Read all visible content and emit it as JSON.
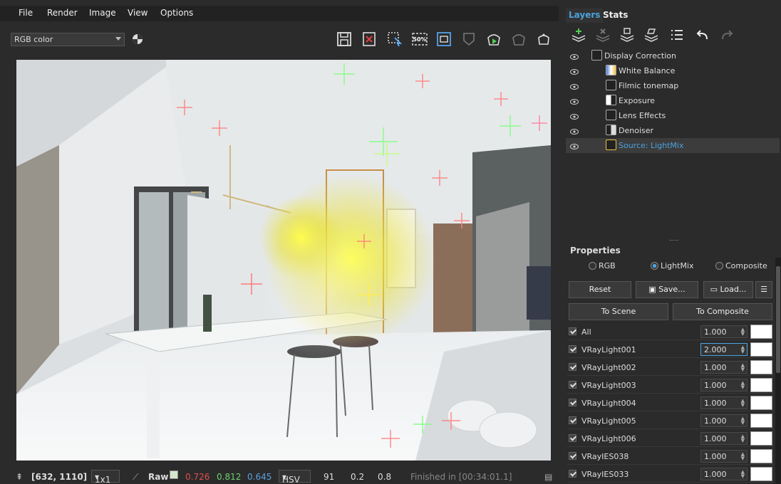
{
  "menu": [
    "File",
    "Render",
    "Image",
    "View",
    "Options"
  ],
  "channel_select": "RGB color",
  "toolbar_icons": [
    "save-icon",
    "clear-icon",
    "region-icon",
    "scale-50-icon",
    "frame-icon",
    "track-icon",
    "render-icon",
    "interactive-render-icon",
    "teapot-icon"
  ],
  "scale_label": "50%",
  "tabs": {
    "layers": "Layers",
    "stats": "Stats"
  },
  "layers": [
    {
      "name": "Display Correction"
    },
    {
      "name": "White Balance"
    },
    {
      "name": "Filmic tonemap"
    },
    {
      "name": "Exposure"
    },
    {
      "name": "Lens Effects"
    },
    {
      "name": "Denoiser"
    },
    {
      "name": "Source: LightMix"
    }
  ],
  "properties": {
    "title": "Properties",
    "modes": [
      "RGB",
      "LightMix",
      "Composite"
    ],
    "selected_mode": "LightMix",
    "reset": "Reset",
    "save": "Save...",
    "load": "Load...",
    "to_scene": "To Scene",
    "to_composite": "To Composite",
    "lights": [
      {
        "name": "All",
        "value": "1.000"
      },
      {
        "name": "VRayLight001",
        "value": "2.000"
      },
      {
        "name": "VRayLight002",
        "value": "1.000"
      },
      {
        "name": "VRayLight003",
        "value": "1.000"
      },
      {
        "name": "VRayLight004",
        "value": "1.000"
      },
      {
        "name": "VRayLight005",
        "value": "1.000"
      },
      {
        "name": "VRayLight006",
        "value": "1.000"
      },
      {
        "name": "VRayIES038",
        "value": "1.000"
      },
      {
        "name": "VRayIES033",
        "value": "1.000"
      }
    ]
  },
  "status": {
    "coords": "[632, 1110]",
    "zoom": "1x1",
    "mode": "Raw",
    "r": "0.726",
    "g": "0.812",
    "b": "0.645",
    "colorspace": "HSV",
    "h": "91",
    "s": "0.2",
    "v": "0.8",
    "finished": "Finished in [00:34:01.1]"
  },
  "colors": {
    "accent": "#4aa3df",
    "red": "#e05050",
    "green": "#6fcf6f",
    "blue": "#5aa0e0"
  }
}
